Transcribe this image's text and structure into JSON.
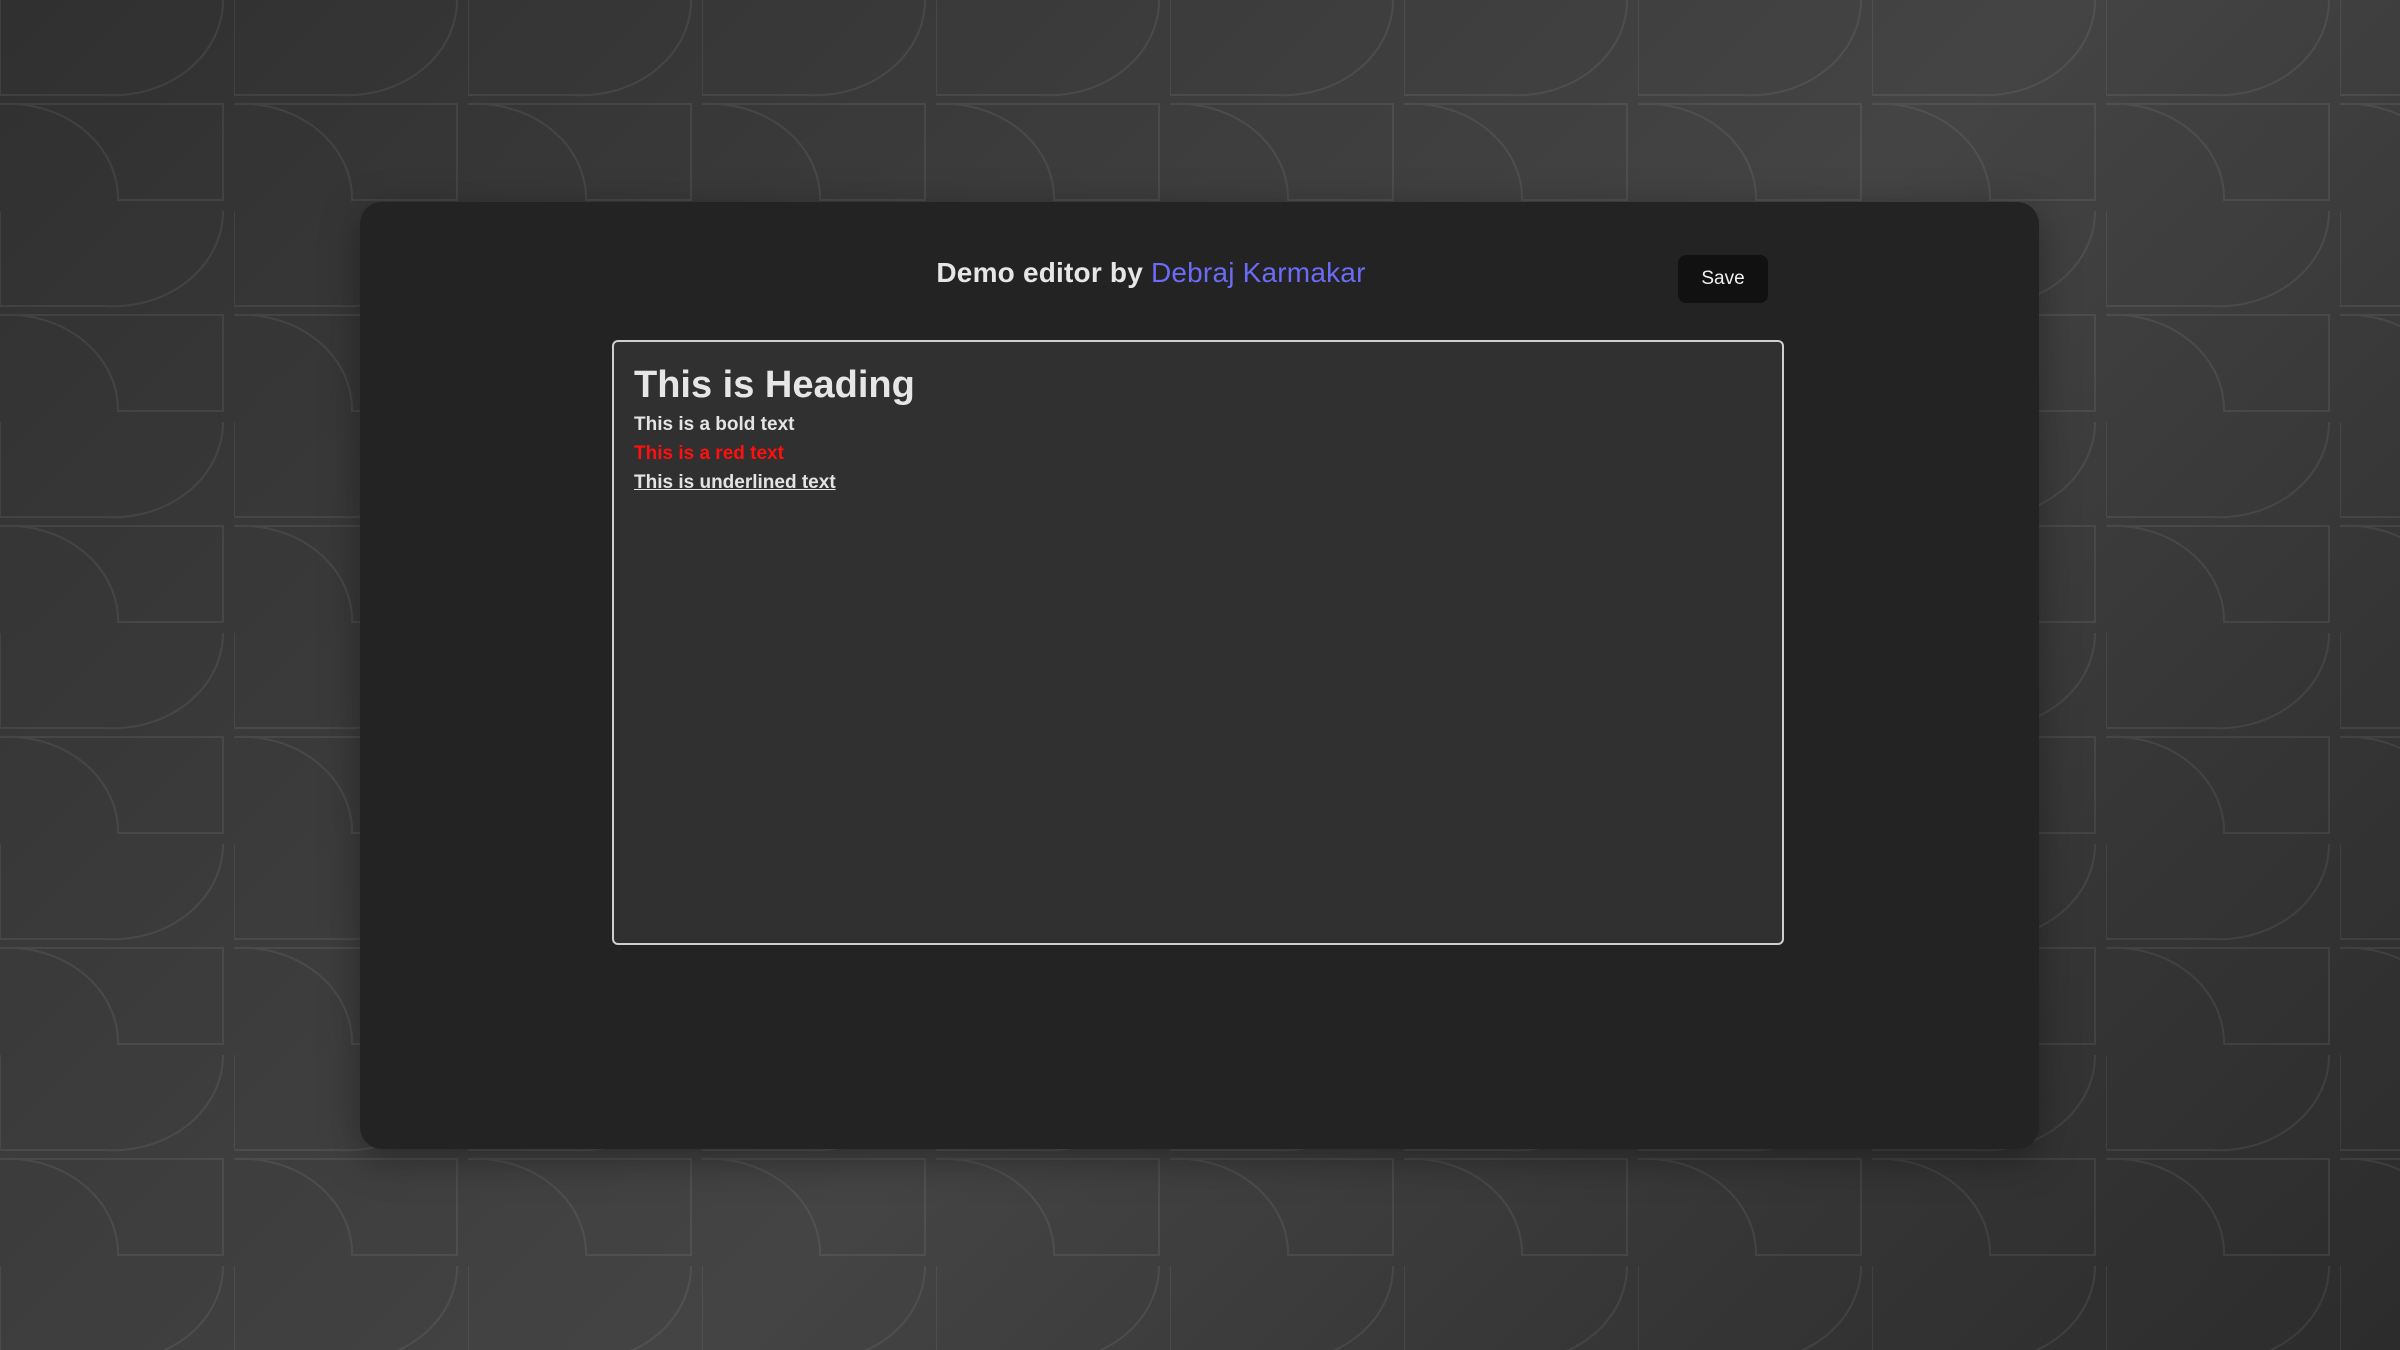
{
  "header": {
    "title_prefix": "Demo editor by",
    "author": "Debraj Karmakar",
    "save_label": "Save"
  },
  "editor": {
    "heading": "This is Heading",
    "bold_text": "This is a bold text",
    "red_text": "This is a red text",
    "underlined_text": "This is underlined text"
  },
  "colors": {
    "author_link": "#6b6bf5",
    "red_text": "#ff0f0f",
    "panel_background": "#232323",
    "editor_background": "#303030"
  }
}
